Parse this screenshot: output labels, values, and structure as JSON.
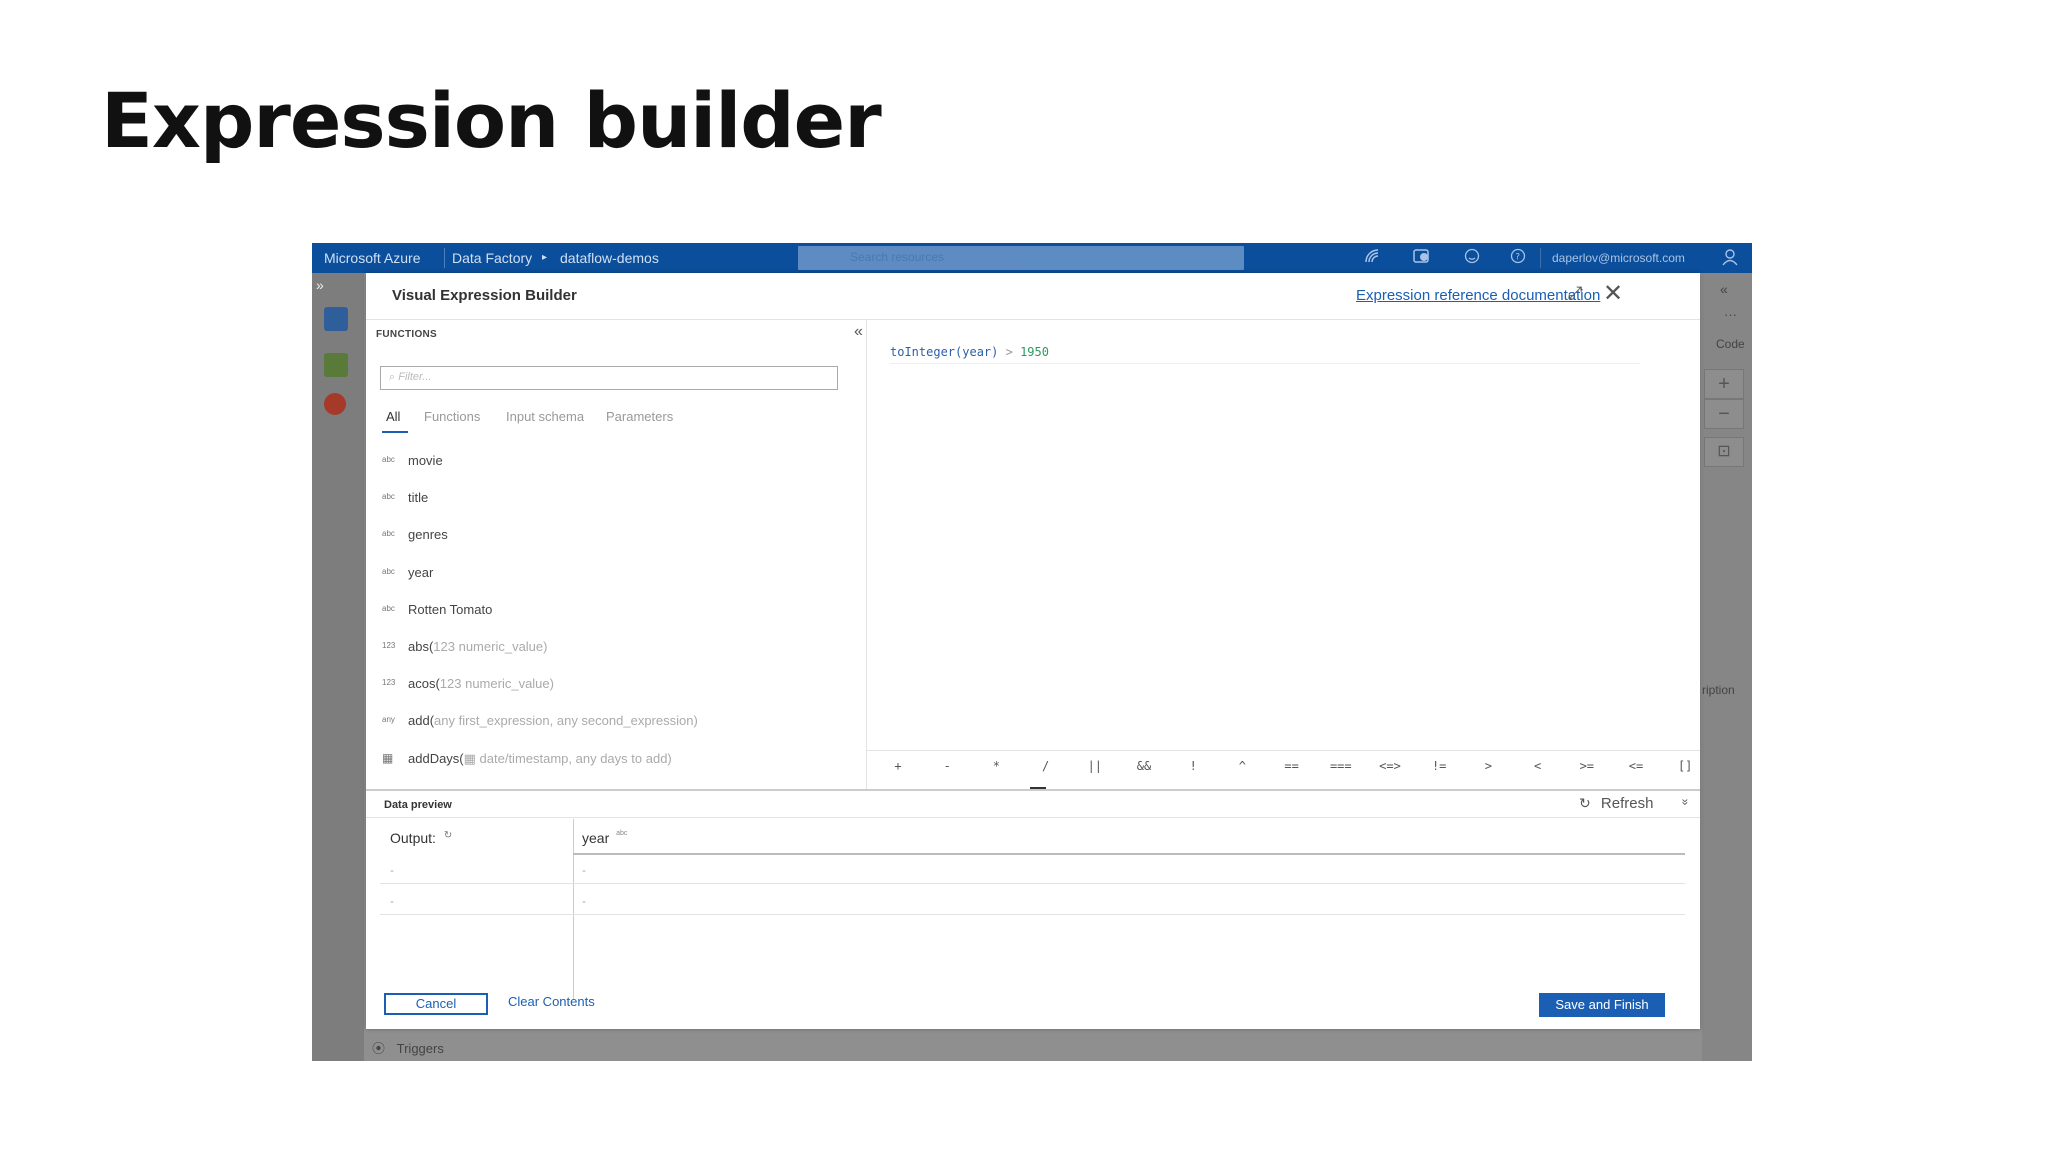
{
  "slide": {
    "title": "Expression builder"
  },
  "topbar": {
    "brand": "Microsoft Azure",
    "crumb_service": "Data Factory",
    "crumb_sep": "▸",
    "crumb_factory": "dataflow-demos",
    "search_placeholder": "Search resources",
    "user": "daperlov@microsoft.com"
  },
  "rail": {
    "expand": "»"
  },
  "right_strip": {
    "collapse": "«",
    "more": "···",
    "code": "Code",
    "zoom_in": "+",
    "zoom_out": "−",
    "fit": "⊡",
    "description": "ription"
  },
  "triggers": {
    "label": "Triggers"
  },
  "dialog": {
    "title": "Visual Expression Builder",
    "doc_link": "Expression reference documentation",
    "maximize": "⤢",
    "close": "✕"
  },
  "functions": {
    "header": "FUNCTIONS",
    "collapse": "«",
    "filter_placeholder": "Filter...",
    "tabs": [
      {
        "label": "All"
      },
      {
        "label": "Functions"
      },
      {
        "label": "Input schema"
      },
      {
        "label": "Parameters"
      }
    ],
    "items": [
      {
        "icon": "abc",
        "name": "movie",
        "args": ""
      },
      {
        "icon": "abc",
        "name": "title",
        "args": ""
      },
      {
        "icon": "abc",
        "name": "genres",
        "args": ""
      },
      {
        "icon": "abc",
        "name": "year",
        "args": ""
      },
      {
        "icon": "abc",
        "name": "Rotten Tomato",
        "args": ""
      },
      {
        "icon": "123",
        "name": "abs(",
        "args": "123 numeric_value)"
      },
      {
        "icon": "123",
        "name": "acos(",
        "args": "123 numeric_value)"
      },
      {
        "icon": "any",
        "name": "add(",
        "args": "any first_expression, any second_expression)"
      },
      {
        "icon": "▦",
        "name": "addDays(",
        "args": "▦ date/timestamp, any days to add)"
      }
    ]
  },
  "editor": {
    "expr_fn": "toInteger(year)",
    "expr_op": " > ",
    "expr_num": "1950"
  },
  "operators": [
    "+",
    "-",
    "*",
    "/",
    "||",
    "&&",
    "!",
    "^",
    "==",
    "===",
    "<=>",
    "!=",
    ">",
    "<",
    ">=",
    "<=",
    "[]"
  ],
  "preview": {
    "title": "Data preview",
    "refresh": "Refresh",
    "collapse": "»",
    "col_output": "Output:",
    "col_output_icon": "↻",
    "col_year": "year",
    "col_year_icon": "abc",
    "rows": [
      [
        "-",
        "-"
      ],
      [
        "-",
        "-"
      ]
    ]
  },
  "footer": {
    "cancel": "Cancel",
    "clear": "Clear Contents",
    "save": "Save and Finish"
  }
}
